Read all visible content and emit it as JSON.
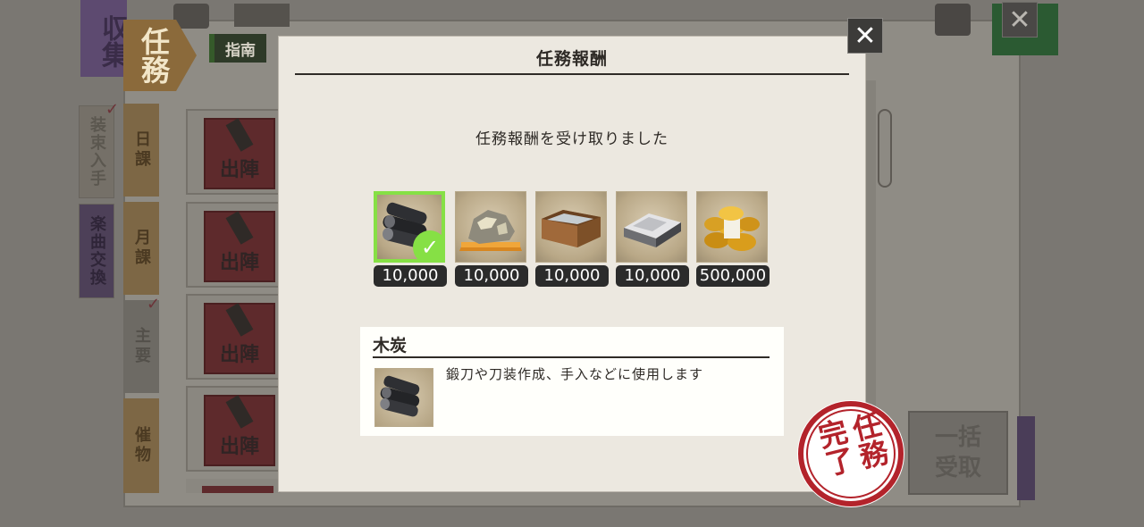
{
  "background": {
    "category_main": "収集",
    "category_task": "任務",
    "guide_label": "指南",
    "side_tabs": [
      "装束入手",
      "楽曲交換"
    ],
    "category_tabs": [
      "日課",
      "月課",
      "主要",
      "催物"
    ],
    "sortie_label": "出陣",
    "bulk_receive": "一括受取",
    "bulk_receive_lines": [
      "一括",
      "受取"
    ]
  },
  "modal": {
    "title": "任務報酬",
    "message": "任務報酬を受け取りました",
    "rewards": [
      {
        "item": "charcoal",
        "quantity": "10,000",
        "selected": true
      },
      {
        "item": "steel",
        "quantity": "10,000",
        "selected": false
      },
      {
        "item": "coolant",
        "quantity": "10,000",
        "selected": false
      },
      {
        "item": "whetstone",
        "quantity": "10,000",
        "selected": false
      },
      {
        "item": "koban",
        "quantity": "500,000",
        "selected": false
      }
    ],
    "detail": {
      "name": "木炭",
      "description": "鍛刀や刀装作成、手入などに使用します"
    },
    "close_icon": "close-icon"
  },
  "stamp": {
    "text_left": "完了",
    "text_right": "任務",
    "color": "#b3232b"
  },
  "colors": {
    "selected_border": "#86e045",
    "modal_bg": "#ece8e0"
  }
}
